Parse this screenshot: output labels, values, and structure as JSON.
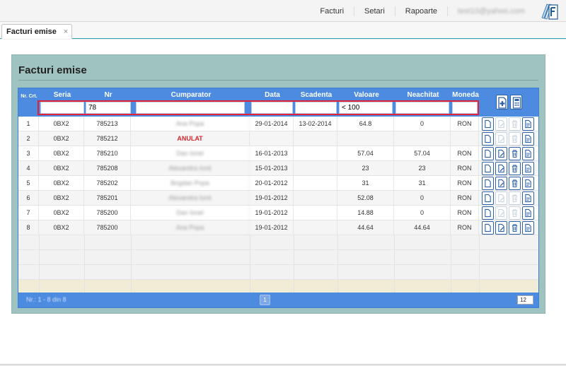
{
  "topnav": {
    "items": [
      "Facturi",
      "Setari",
      "Rapoarte"
    ],
    "user_email": "test10@yahoo.com"
  },
  "tab": {
    "label": "Facturi emise",
    "close_icon": "×"
  },
  "panel": {
    "title": "Facturi emise"
  },
  "grid": {
    "headers": {
      "nr_crt": "Nr. Crt.",
      "seria": "Seria",
      "nr": "Nr",
      "cumparator": "Cumparator",
      "data": "Data",
      "scadenta": "Scadenta",
      "valoare": "Valoare",
      "neachitat": "Neachitat",
      "moneda": "Moneda"
    },
    "filters": {
      "seria": "",
      "nr": "78",
      "cumparator": "",
      "data": "",
      "scadenta": "",
      "valoare": "< 100",
      "neachitat": "",
      "moneda": ""
    },
    "rows": [
      {
        "crt": "1",
        "seria": "0BX2",
        "nr": "785213",
        "cumparator": "Ana Popa",
        "data": "29-01-2014",
        "scadenta": "13-02-2014",
        "valoare": "64.8",
        "neachitat": "0",
        "moneda": "RON",
        "anulat": false,
        "editable": false
      },
      {
        "crt": "2",
        "seria": "0BX2",
        "nr": "785212",
        "cumparator": "ANULAT",
        "data": "",
        "scadenta": "",
        "valoare": "",
        "neachitat": "",
        "moneda": "",
        "anulat": true,
        "editable": false
      },
      {
        "crt": "3",
        "seria": "0BX2",
        "nr": "785210",
        "cumparator": "Dan Ionel",
        "data": "16-01-2013",
        "scadenta": "",
        "valoare": "57.04",
        "neachitat": "57.04",
        "moneda": "RON",
        "anulat": false,
        "editable": true
      },
      {
        "crt": "4",
        "seria": "0BX2",
        "nr": "785208",
        "cumparator": "Alexandra Ionit",
        "data": "15-01-2013",
        "scadenta": "",
        "valoare": "23",
        "neachitat": "23",
        "moneda": "RON",
        "anulat": false,
        "editable": true
      },
      {
        "crt": "5",
        "seria": "0BX2",
        "nr": "785202",
        "cumparator": "Bogdan Popa",
        "data": "20-01-2012",
        "scadenta": "",
        "valoare": "31",
        "neachitat": "31",
        "moneda": "RON",
        "anulat": false,
        "editable": true
      },
      {
        "crt": "6",
        "seria": "0BX2",
        "nr": "785201",
        "cumparator": "Alexandra Ionit",
        "data": "19-01-2012",
        "scadenta": "",
        "valoare": "52.08",
        "neachitat": "0",
        "moneda": "RON",
        "anulat": false,
        "editable": false
      },
      {
        "crt": "7",
        "seria": "0BX2",
        "nr": "785200",
        "cumparator": "Dan Ionel",
        "data": "19-01-2012",
        "scadenta": "",
        "valoare": "14.88",
        "neachitat": "0",
        "moneda": "RON",
        "anulat": false,
        "editable": false
      },
      {
        "crt": "8",
        "seria": "0BX2",
        "nr": "785200",
        "cumparator": "Ana Popa",
        "data": "19-01-2012",
        "scadenta": "",
        "valoare": "44.64",
        "neachitat": "44.64",
        "moneda": "RON",
        "anulat": false,
        "editable": true
      }
    ],
    "footer": {
      "count": "Nr.: 1 - 8 din 8",
      "page": "1",
      "page_size": "12"
    }
  },
  "colors": {
    "header_blue": "#4c8be0",
    "panel_teal": "#9fc3c1",
    "filter_highlight": "#e0213a",
    "anulat_red": "#d4262b"
  },
  "icons": {
    "row_actions": [
      "document-icon",
      "edit-icon",
      "delete-icon",
      "print-icon"
    ],
    "header_actions": [
      "add-invoice-icon",
      "calculator-icon"
    ],
    "logo": "invoice-logo-icon"
  }
}
